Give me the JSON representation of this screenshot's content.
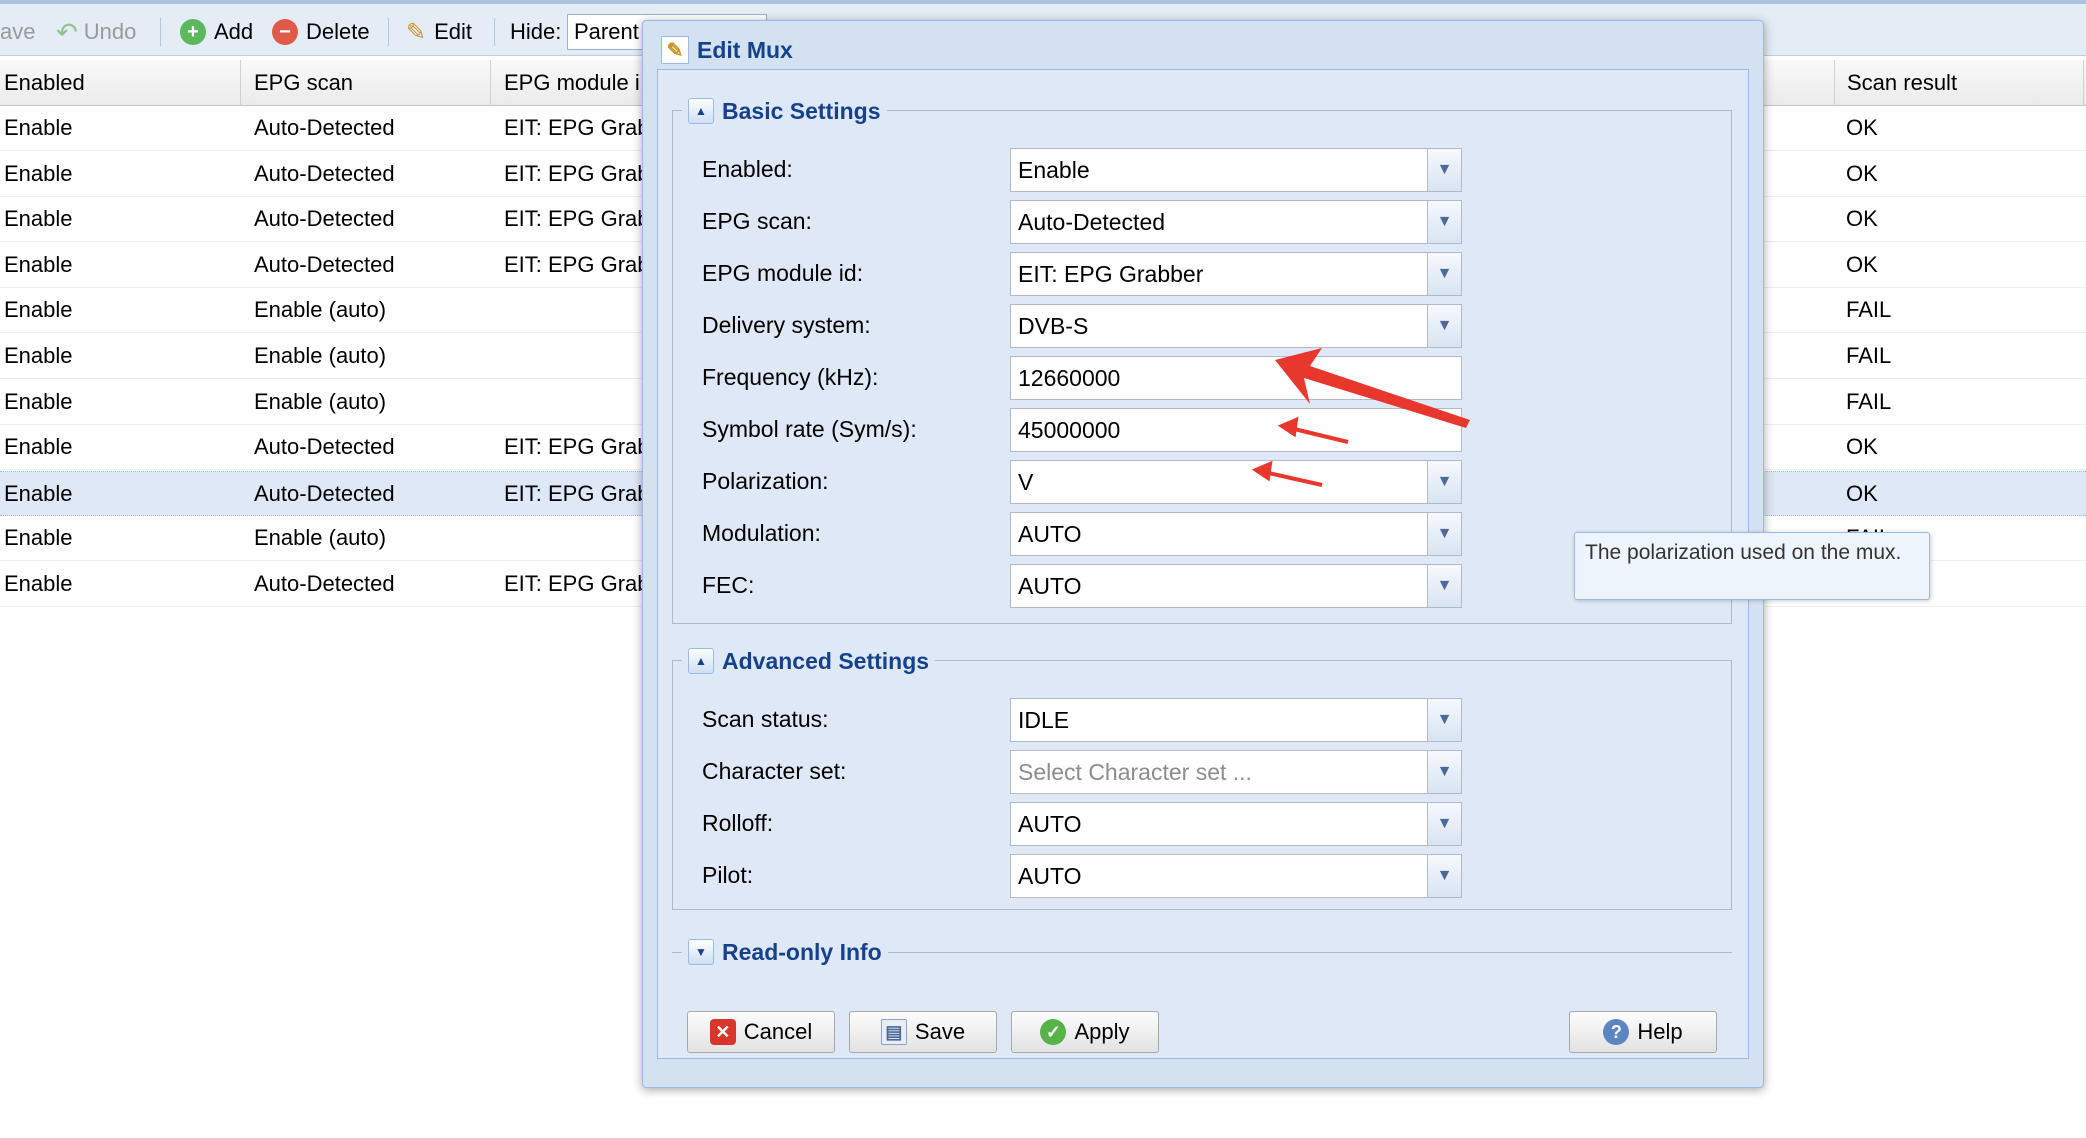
{
  "toolbar": {
    "save_label": "ave",
    "undo_label": "Undo",
    "add_label": "Add",
    "delete_label": "Delete",
    "edit_label": "Edit",
    "hide_label": "Hide:",
    "hide_value": "Parent"
  },
  "grid": {
    "columns": [
      "Enabled",
      "EPG scan",
      "EPG module i",
      "Scan result"
    ],
    "rows": [
      {
        "enabled": "Enable",
        "epg_scan": "Auto-Detected",
        "epg_module": "EIT: EPG Grab",
        "scan_result": "OK"
      },
      {
        "enabled": "Enable",
        "epg_scan": "Auto-Detected",
        "epg_module": "EIT: EPG Grab",
        "scan_result": "OK"
      },
      {
        "enabled": "Enable",
        "epg_scan": "Auto-Detected",
        "epg_module": "EIT: EPG Grab",
        "scan_result": "OK"
      },
      {
        "enabled": "Enable",
        "epg_scan": "Auto-Detected",
        "epg_module": "EIT: EPG Grab",
        "scan_result": "OK"
      },
      {
        "enabled": "Enable",
        "epg_scan": "Enable (auto)",
        "epg_module": "",
        "scan_result": "FAIL"
      },
      {
        "enabled": "Enable",
        "epg_scan": "Enable (auto)",
        "epg_module": "",
        "scan_result": "FAIL"
      },
      {
        "enabled": "Enable",
        "epg_scan": "Enable (auto)",
        "epg_module": "",
        "scan_result": "FAIL"
      },
      {
        "enabled": "Enable",
        "epg_scan": "Auto-Detected",
        "epg_module": "EIT: EPG Grab",
        "scan_result": "OK"
      },
      {
        "enabled": "Enable",
        "epg_scan": "Auto-Detected",
        "epg_module": "EIT: EPG Grab",
        "scan_result": "OK"
      },
      {
        "enabled": "Enable",
        "epg_scan": "Enable (auto)",
        "epg_module": "",
        "scan_result": "FAIL"
      },
      {
        "enabled": "Enable",
        "epg_scan": "Auto-Detected",
        "epg_module": "EIT: EPG Grab",
        "scan_result": ""
      }
    ]
  },
  "dialog": {
    "title": "Edit Mux",
    "basic": {
      "legend": "Basic Settings",
      "fields": [
        {
          "label": "Enabled:",
          "value": "Enable"
        },
        {
          "label": "EPG scan:",
          "value": "Auto-Detected"
        },
        {
          "label": "EPG module id:",
          "value": "EIT: EPG Grabber"
        },
        {
          "label": "Delivery system:",
          "value": "DVB-S"
        },
        {
          "label": "Frequency (kHz):",
          "value": "12660000"
        },
        {
          "label": "Symbol rate (Sym/s):",
          "value": "45000000"
        },
        {
          "label": "Polarization:",
          "value": "V"
        },
        {
          "label": "Modulation:",
          "value": "AUTO"
        },
        {
          "label": "FEC:",
          "value": "AUTO"
        }
      ]
    },
    "advanced": {
      "legend": "Advanced Settings",
      "fields": [
        {
          "label": "Scan status:",
          "value": "IDLE"
        },
        {
          "label": "Character set:",
          "placeholder": "Select Character set ..."
        },
        {
          "label": "Rolloff:",
          "value": "AUTO"
        },
        {
          "label": "Pilot:",
          "value": "AUTO"
        }
      ]
    },
    "readonly": {
      "legend": "Read-only Info"
    },
    "buttons": {
      "cancel": "Cancel",
      "save": "Save",
      "apply": "Apply",
      "help": "Help"
    },
    "tooltip": "The polarization used on the mux."
  },
  "colors": {
    "annotation_arrow": "#e8372c",
    "legend_text": "#15428b"
  },
  "icons": {
    "dropdown": "▼",
    "collapse": "▲",
    "expand": "▼"
  }
}
